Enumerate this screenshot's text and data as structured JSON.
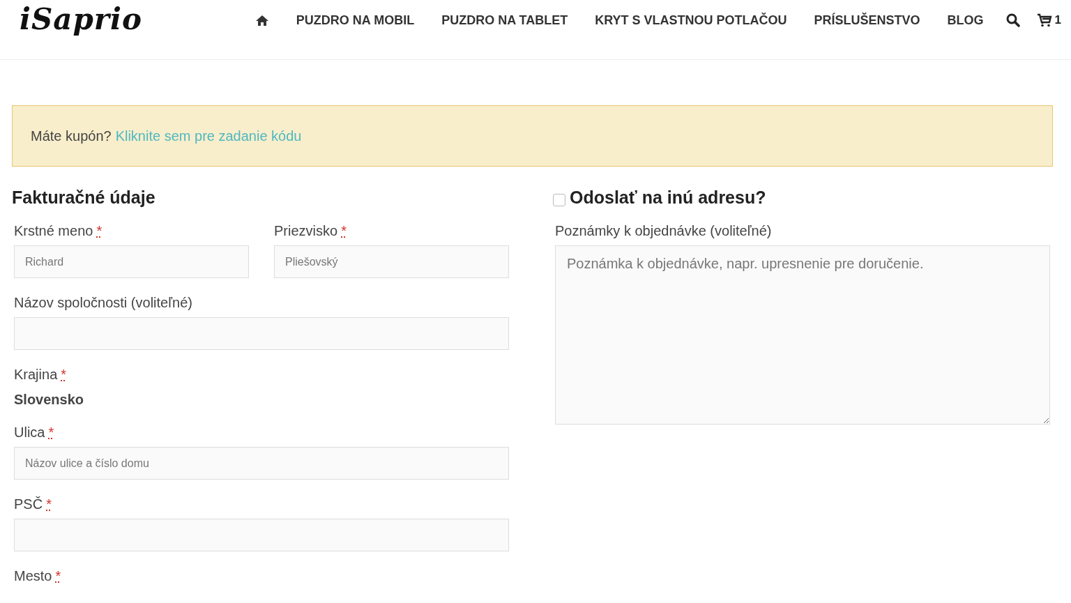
{
  "header": {
    "logo": "iSaprio",
    "nav": [
      "PUZDRO NA MOBIL",
      "PUZDRO NA TABLET",
      "KRYT S VLASTNOU POTLAČOU",
      "PRÍSLUŠENSTVO",
      "BLOG"
    ],
    "cart_count": "1"
  },
  "coupon": {
    "text": "Máte kupón?",
    "link": "Kliknite sem pre zadanie kódu"
  },
  "billing": {
    "title": "Fakturačné údaje",
    "rows": [
      {
        "fields": [
          {
            "kind": "text",
            "label": "Krstné meno",
            "required_mark": "*",
            "placeholder": "Richard"
          },
          {
            "kind": "text",
            "label": "Priezvisko",
            "required_mark": "*",
            "placeholder": "Pliešovský"
          }
        ]
      },
      {
        "fields": [
          {
            "kind": "text",
            "label": "Názov spoločnosti (voliteľné)"
          }
        ]
      },
      {
        "fields": [
          {
            "kind": "static",
            "label": "Krajina",
            "required_mark": "*",
            "value": "Slovensko"
          }
        ]
      },
      {
        "fields": [
          {
            "kind": "text",
            "label": "Ulica",
            "required_mark": "*",
            "placeholder": "Názov ulice a číslo domu"
          }
        ]
      },
      {
        "fields": [
          {
            "kind": "text",
            "label": "PSČ",
            "required_mark": "*"
          }
        ]
      },
      {
        "fields": [
          {
            "kind": "label",
            "label": "Mesto",
            "required_mark": "*"
          }
        ]
      }
    ]
  },
  "shipping": {
    "title": "Odoslať na inú adresu?",
    "checked": false,
    "notes": {
      "kind": "textarea",
      "label": "Poznámky k objednávke (voliteľné)",
      "placeholder": "Poznámka k objednávke, napr. upresnenie pre doručenie."
    }
  }
}
